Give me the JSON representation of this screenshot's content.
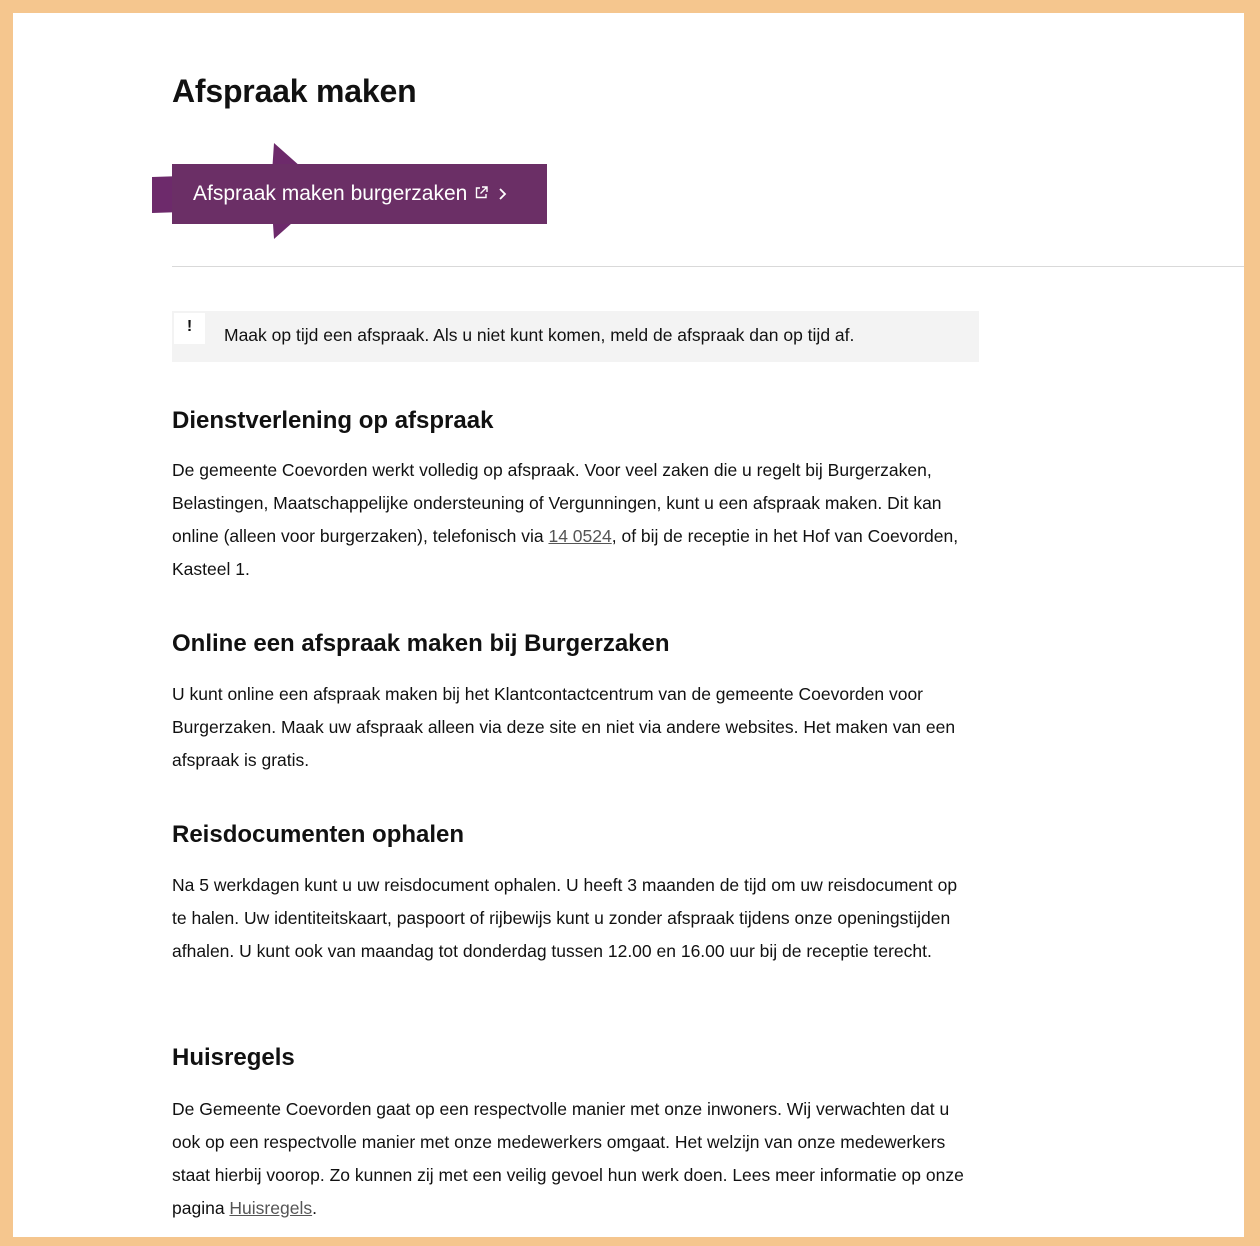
{
  "page": {
    "title": "Afspraak maken",
    "cta_label": "Afspraak maken burgerzaken"
  },
  "notice": {
    "mark": "!",
    "text": "Maak op tijd een afspraak. Als u niet kunt komen, meld de afspraak dan op tijd af."
  },
  "sections": {
    "s1": {
      "heading": "Dienstverlening op afspraak",
      "text_before_link": "De gemeente Coevorden werkt volledig op afspraak. Voor veel zaken die u regelt bij Burgerzaken, Belastingen, Maatschappelijke ondersteuning of Vergunningen, kunt u een afspraak maken. Dit kan online (alleen voor burgerzaken), telefonisch via ",
      "link": "14 0524",
      "text_after_link": ", of bij de receptie in het Hof van Coevorden, Kasteel 1."
    },
    "s2": {
      "heading": "Online een afspraak maken bij Burgerzaken",
      "text": "U kunt online een afspraak maken bij het Klantcontactcentrum van de gemeente Coevorden voor Burgerzaken. Maak uw afspraak alleen via deze site en niet via andere websites. Het maken van een afspraak is gratis."
    },
    "s3": {
      "heading": "Reisdocumenten ophalen",
      "text": "Na 5 werkdagen kunt u uw reisdocument ophalen. U heeft 3 maanden de tijd om uw reisdocument op te halen. Uw identiteitskaart, paspoort of rijbewijs kunt u zonder afspraak tijdens onze openingstijden afhalen. U kunt ook van maandag tot donderdag tussen 12.00 en 16.00 uur bij de receptie terecht."
    },
    "s4": {
      "heading": "Huisregels",
      "text_before_link": "De Gemeente Coevorden gaat op een respectvolle manier met onze inwoners. Wij verwachten dat u ook op een respectvolle manier met onze medewerkers omgaat. Het welzijn van onze medewerkers staat hierbij voorop. Zo kunnen zij met een veilig gevoel hun werk doen. Lees meer informatie op onze pagina ",
      "link": "Huisregels",
      "text_after_link": "."
    }
  },
  "colors": {
    "frame": "#f5c68e",
    "brand_purple": "#6b2f66",
    "arrow_purple": "#6d2a6b",
    "notice_bg": "#f3f3f3"
  },
  "icons": [
    "arrow-pointer-icon",
    "external-link-icon",
    "chevron-right-icon"
  ]
}
